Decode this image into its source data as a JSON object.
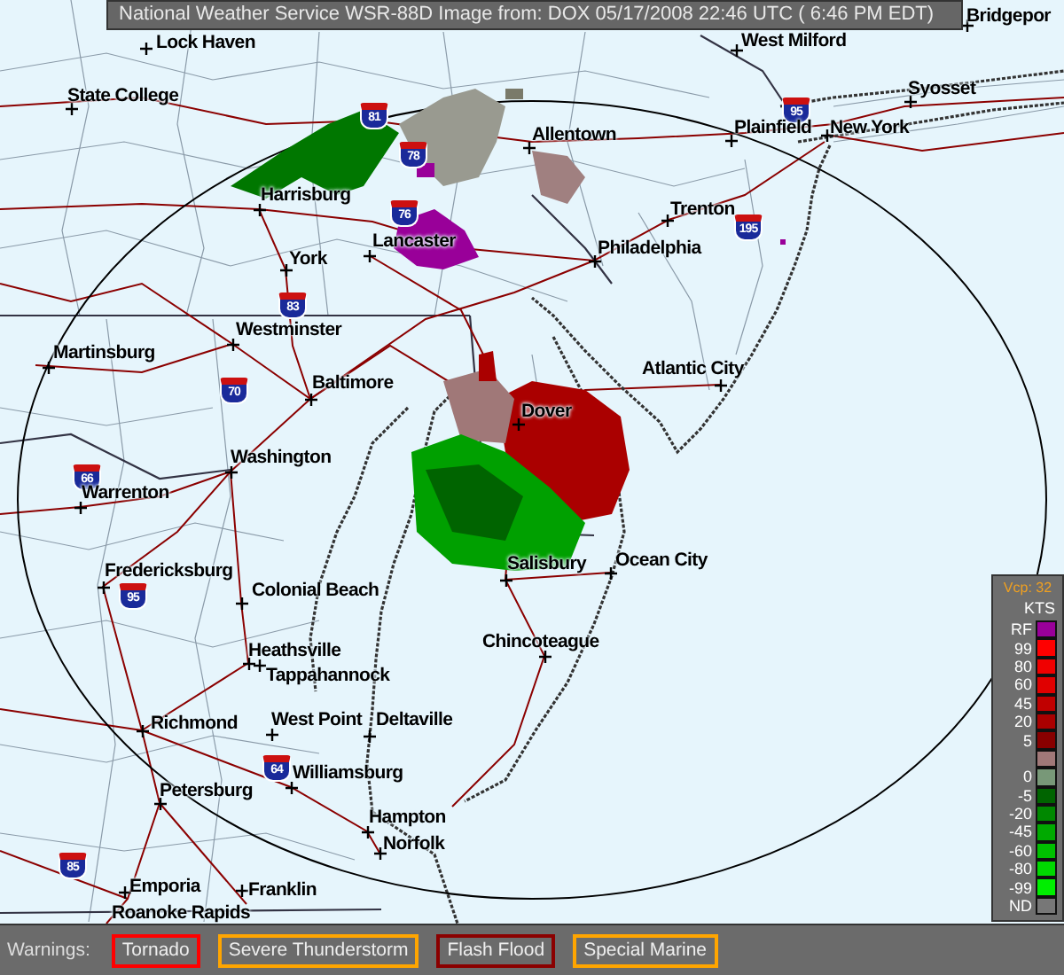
{
  "title_bar": {
    "text": "National Weather Service WSR-88D Image from: DOX 05/17/2008 22:46 UTC ( 6:46 PM EDT)"
  },
  "map": {
    "cities": [
      {
        "name": "Lock Haven"
      },
      {
        "name": "West Milford"
      },
      {
        "name": "Bridgepor"
      },
      {
        "name": "State College"
      },
      {
        "name": "Syosset"
      },
      {
        "name": "Plainfield"
      },
      {
        "name": "New York"
      },
      {
        "name": "Allentown"
      },
      {
        "name": "Harrisburg"
      },
      {
        "name": "Trenton"
      },
      {
        "name": "Lancaster"
      },
      {
        "name": "Philadelphia"
      },
      {
        "name": "York"
      },
      {
        "name": "Westminster"
      },
      {
        "name": "Martinsburg"
      },
      {
        "name": "Atlantic City"
      },
      {
        "name": "Baltimore"
      },
      {
        "name": "Dover"
      },
      {
        "name": "Washington"
      },
      {
        "name": "Warrenton"
      },
      {
        "name": "Salisbury"
      },
      {
        "name": "Ocean City"
      },
      {
        "name": "Fredericksburg"
      },
      {
        "name": "Colonial Beach"
      },
      {
        "name": "Heathsville"
      },
      {
        "name": "Chincoteague"
      },
      {
        "name": "Tappahannock"
      },
      {
        "name": "Richmond"
      },
      {
        "name": "West Point"
      },
      {
        "name": "Deltaville"
      },
      {
        "name": "Williamsburg"
      },
      {
        "name": "Petersburg"
      },
      {
        "name": "Hampton"
      },
      {
        "name": "Norfolk"
      },
      {
        "name": "Emporia"
      },
      {
        "name": "Franklin"
      },
      {
        "name": "Roanoke Rapids"
      }
    ],
    "interstates": [
      {
        "number": "81"
      },
      {
        "number": "78"
      },
      {
        "number": "76"
      },
      {
        "number": "83"
      },
      {
        "number": "70"
      },
      {
        "number": "195"
      },
      {
        "number": "95"
      },
      {
        "number": "66"
      },
      {
        "number": "95"
      },
      {
        "number": "64"
      },
      {
        "number": "85"
      }
    ]
  },
  "legend": {
    "vcp": "Vcp: 32",
    "units": "KTS",
    "items": [
      {
        "label": "RF",
        "color": "#990099"
      },
      {
        "label": "99",
        "color": "#ff0000"
      },
      {
        "label": "80",
        "color": "#f00000"
      },
      {
        "label": "60",
        "color": "#e00000"
      },
      {
        "label": "45",
        "color": "#c00000"
      },
      {
        "label": "20",
        "color": "#aa0000"
      },
      {
        "label": "5",
        "color": "#880000"
      },
      {
        "color": "#a07878"
      },
      {
        "label": "0",
        "color": "#789878"
      },
      {
        "label": "-5",
        "color": "#006400"
      },
      {
        "label": "-20",
        "color": "#008800"
      },
      {
        "label": "-45",
        "color": "#00aa00"
      },
      {
        "label": "-60",
        "color": "#00c000"
      },
      {
        "label": "-80",
        "color": "#00d800"
      },
      {
        "label": "-99",
        "color": "#00ee00"
      },
      {
        "label": "ND",
        "color": "#777777"
      }
    ]
  },
  "warnings": {
    "label": "Warnings:",
    "items": [
      {
        "label": "Tornado",
        "color": "#ff0000"
      },
      {
        "label": "Severe Thunderstorm",
        "color": "#ffa500"
      },
      {
        "label": "Flash Flood",
        "color": "#8b0000"
      },
      {
        "label": "Special Marine",
        "color": "#ffa500"
      }
    ]
  }
}
